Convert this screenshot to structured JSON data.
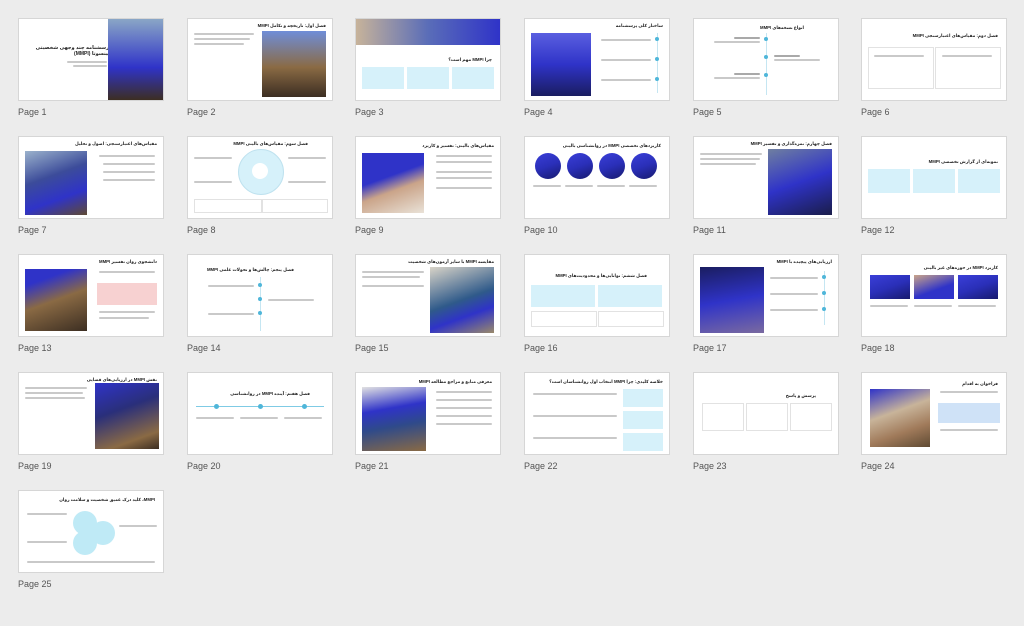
{
  "accent_color": "#d6f1fa",
  "brand_blue": "#2f33c8",
  "slides": [
    {
      "caption": "Page 1",
      "title": "پرسشنامه چند وجهی شخصیتی مینسوتا (MMPI)"
    },
    {
      "caption": "Page 2",
      "title": "فصل اول: تاریخچه و تکامل MMPI"
    },
    {
      "caption": "Page 3",
      "title": "چرا MMPI مهم است؟"
    },
    {
      "caption": "Page 4",
      "title": "ساختار کلی پرسشنامه"
    },
    {
      "caption": "Page 5",
      "title": "انواع نسخه‌های MMPI"
    },
    {
      "caption": "Page 6",
      "title": "فصل دوم: مقیاس‌های اعتبارسنجی MMPI"
    },
    {
      "caption": "Page 7",
      "title": "مقیاس‌های اعتبارسنجی: اصول و تحلیل"
    },
    {
      "caption": "Page 8",
      "title": "فصل سوم: مقیاس‌های بالینی MMPI"
    },
    {
      "caption": "Page 9",
      "title": "مقیاس‌های بالینی: تفسیر و کاربرد"
    },
    {
      "caption": "Page 10",
      "title": "کاربردهای تخصصی MMPI در روانشناسی بالینی"
    },
    {
      "caption": "Page 11",
      "title": "فصل چهارم: نمره‌گذاری و تفسیر MMPI"
    },
    {
      "caption": "Page 12",
      "title": "نمونه‌ای از گزارش تخصصی MMPI"
    },
    {
      "caption": "Page 13",
      "title": "دانشجوی روان تفسیر MMPI"
    },
    {
      "caption": "Page 14",
      "title": "فصل پنجم: چالش‌ها و تحولات علمی MMPI"
    },
    {
      "caption": "Page 15",
      "title": "مقایسه MMPI با سایر آزمون‌های شخصیت"
    },
    {
      "caption": "Page 16",
      "title": "فصل ششم: توانایی‌ها و محدودیت‌های MMPI"
    },
    {
      "caption": "Page 17",
      "title": "ارزیابی‌های پیچیده با MMPI"
    },
    {
      "caption": "Page 18",
      "title": "کاربرد MMPI در حوزه‌های غیر بالینی"
    },
    {
      "caption": "Page 19",
      "title": "نقش MMPI در ارزیابی‌های قضایی"
    },
    {
      "caption": "Page 20",
      "title": "فصل هفتم: آینده MMPI در روانشناسی"
    },
    {
      "caption": "Page 21",
      "title": "معرفی منابع و مراجع مطالعه MMPI"
    },
    {
      "caption": "Page 22",
      "title": "خلاصه کلیدی: چرا MMPI انتخاب اول روانشناسان است؟"
    },
    {
      "caption": "Page 23",
      "title": "پرسش و پاسخ"
    },
    {
      "caption": "Page 24",
      "title": "فراخوان به اقدام"
    },
    {
      "caption": "Page 25",
      "title": "MMPI، کلید درک عمیق شخصیت و سلامت روان"
    }
  ]
}
